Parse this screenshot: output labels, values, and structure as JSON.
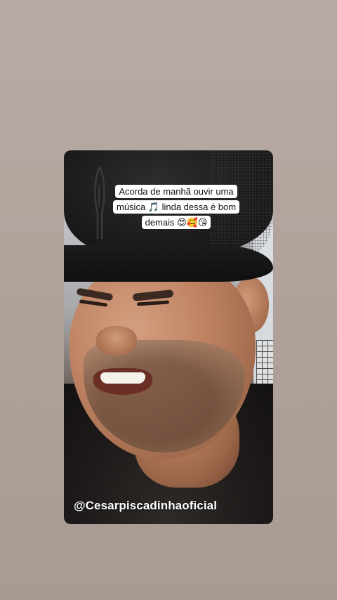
{
  "story": {
    "caption": "Acorda de manhã ouvir uma música 🎵 linda dessa é bom demais 😍🥰😘",
    "handle": "@Cesarpiscadinhaoficial"
  },
  "colors": {
    "background": "#b3a59e",
    "caption_bg": "#ffffff",
    "caption_text": "#111111",
    "handle_text": "#ffffff"
  }
}
